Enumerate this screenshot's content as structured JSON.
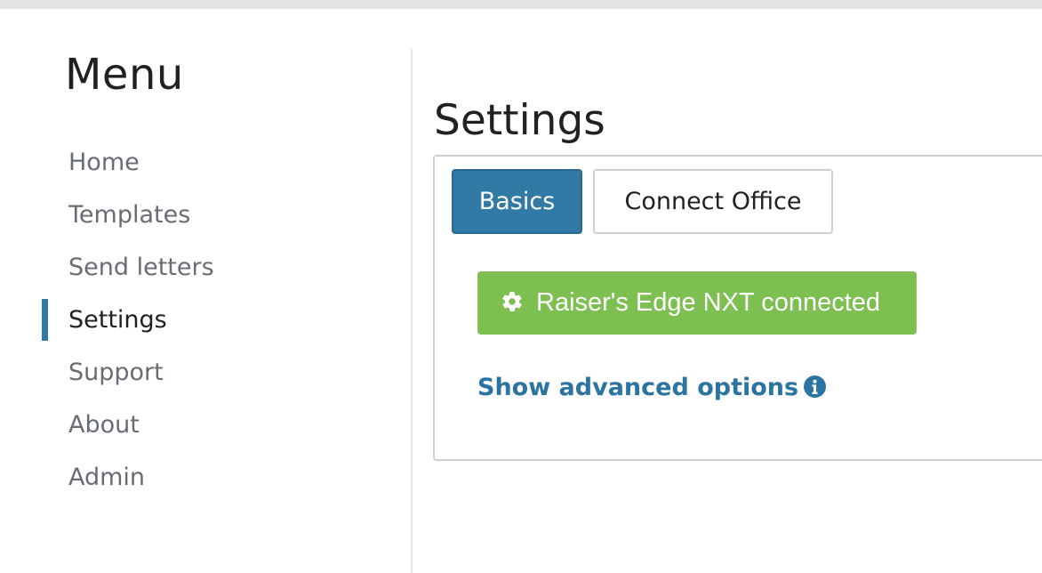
{
  "sidebar": {
    "title": "Menu",
    "items": [
      {
        "label": "Home",
        "active": false
      },
      {
        "label": "Templates",
        "active": false
      },
      {
        "label": "Send letters",
        "active": false
      },
      {
        "label": "Settings",
        "active": true
      },
      {
        "label": "Support",
        "active": false
      },
      {
        "label": "About",
        "active": false
      },
      {
        "label": "Admin",
        "active": false
      }
    ]
  },
  "main": {
    "title": "Settings",
    "tabs": [
      {
        "label": "Basics",
        "active": true
      },
      {
        "label": "Connect Office",
        "active": false
      }
    ],
    "connection_button": {
      "icon": "gear-icon",
      "label": "Raiser's Edge NXT connected"
    },
    "advanced_link": {
      "label": "Show advanced options",
      "icon": "info-icon"
    }
  },
  "colors": {
    "accent": "#317aa6",
    "success": "#7ebf52",
    "link": "#2b74a1"
  }
}
